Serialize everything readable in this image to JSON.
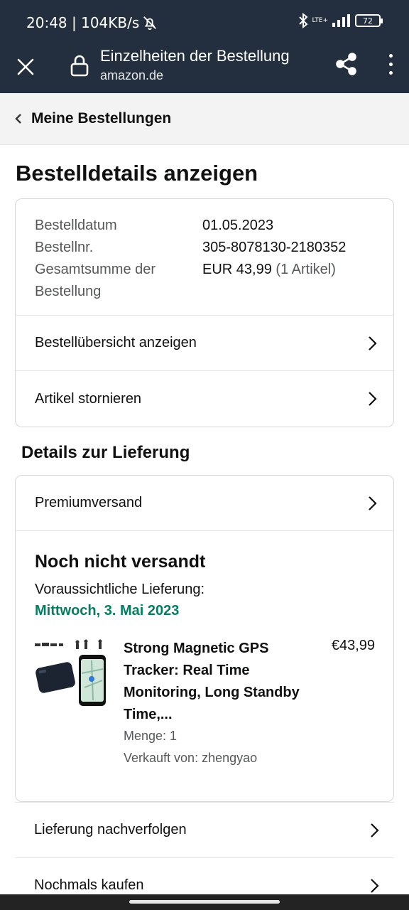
{
  "status_bar": {
    "time_speed": "20:48 | 104KB/s",
    "network": "LTE+",
    "battery": "72"
  },
  "app_bar": {
    "title": "Einzelheiten der Bestellung",
    "url": "amazon.de"
  },
  "breadcrumb": {
    "label": "Meine Bestellungen"
  },
  "page": {
    "title": "Bestelldetails anzeigen"
  },
  "order_info": {
    "date_label": "Bestelldatum",
    "date_value": "01.05.2023",
    "number_label": "Bestellnr.",
    "number_value": "305-8078130-2180352",
    "total_label": "Gesamtsumme der Bestellung",
    "total_value": "EUR 43,99",
    "total_count": "(1 Artikel)"
  },
  "order_actions": [
    {
      "label": "Bestellübersicht anzeigen"
    },
    {
      "label": "Artikel stornieren"
    }
  ],
  "delivery": {
    "section_title": "Details zur Lieferung",
    "shipping_method": "Premiumversand",
    "status": "Noch nicht versandt",
    "eta_label": "Voraussichtliche Lieferung:",
    "eta_date": "Mittwoch, 3. Mai 2023",
    "eta_color": "#067d62"
  },
  "product": {
    "title": "Strong Magnetic GPS Tracker: Real Time Monitoring, Long Standby Time,...",
    "price": "€43,99",
    "quantity": "Menge: 1",
    "seller": "Verkauft von: zhengyao"
  },
  "bottom_actions": [
    {
      "label": "Lieferung nachverfolgen"
    },
    {
      "label": "Nochmals kaufen"
    }
  ],
  "colors": {
    "header_bg": "#232f3e",
    "breadcrumb_bg": "#f3f3f3",
    "border": "#d5d9d9"
  }
}
